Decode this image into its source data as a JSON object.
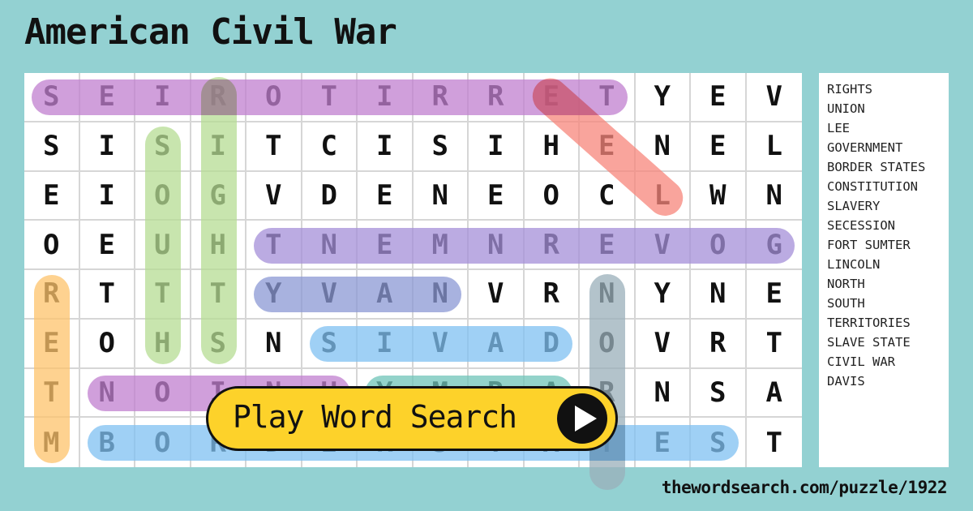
{
  "title": "American Civil War",
  "grid": {
    "rows": [
      [
        "S",
        "E",
        "I",
        "R",
        "O",
        "T",
        "I",
        "R",
        "R",
        "E",
        "T",
        "Y",
        "E",
        "V"
      ],
      [
        "S",
        "I",
        "S",
        "I",
        "T",
        "C",
        "I",
        "S",
        "I",
        "H",
        "E",
        "N",
        "E",
        "L"
      ],
      [
        "E",
        "I",
        "O",
        "G",
        "V",
        "D",
        "E",
        "N",
        "E",
        "O",
        "C",
        "L",
        "W",
        "N"
      ],
      [
        "O",
        "E",
        "U",
        "H",
        "T",
        "N",
        "E",
        "M",
        "N",
        "R",
        "E",
        "V",
        "O",
        "G"
      ],
      [
        "R",
        "T",
        "T",
        "T",
        "Y",
        "V",
        "A",
        "N",
        "V",
        "R",
        "N",
        "Y",
        "N",
        "E"
      ],
      [
        "E",
        "O",
        "H",
        "S",
        "N",
        "S",
        "I",
        "V",
        "A",
        "D",
        "O",
        "V",
        "R",
        "T"
      ],
      [
        "T",
        "N",
        "O",
        "I",
        "N",
        "U",
        "Y",
        "M",
        "R",
        "A",
        "R",
        "N",
        "S",
        "A"
      ],
      [
        "M",
        "B",
        "O",
        "R",
        "D",
        "E",
        "R",
        "S",
        "T",
        "A",
        "T",
        "E",
        "S",
        "T"
      ]
    ],
    "highlights": [
      {
        "word": "TERRITORIES",
        "start": [
          0,
          0
        ],
        "end": [
          0,
          10
        ],
        "color": "#c17fcf"
      },
      {
        "word": "LEE",
        "start": [
          2,
          11
        ],
        "end": [
          0,
          9
        ],
        "color": "#f7857a"
      },
      {
        "word": "SOUTH",
        "start": [
          1,
          2
        ],
        "end": [
          5,
          2
        ],
        "color": "#b5dd93"
      },
      {
        "word": "RIGHTS",
        "start": [
          0,
          3
        ],
        "end": [
          5,
          3
        ],
        "color": "#b5dd93"
      },
      {
        "word": "GOVERNMENT",
        "start": [
          3,
          13
        ],
        "end": [
          3,
          4
        ],
        "color": "#a48fd8"
      },
      {
        "word": "NAVY",
        "start": [
          4,
          7
        ],
        "end": [
          4,
          4
        ],
        "color": "#8b98d4"
      },
      {
        "word": "DAVIS",
        "start": [
          5,
          9
        ],
        "end": [
          5,
          5
        ],
        "color": "#7fc0f2"
      },
      {
        "word": "NORTH",
        "start": [
          4,
          10
        ],
        "end": [
          8,
          10
        ],
        "color": "#9aafba"
      },
      {
        "word": "FORT SUMTER",
        "start": [
          7,
          0
        ],
        "end": [
          4,
          0
        ],
        "color": "#fec36a"
      },
      {
        "word": "UNION",
        "start": [
          6,
          5
        ],
        "end": [
          6,
          1
        ],
        "color": "#c17fcf"
      },
      {
        "word": "ARMY",
        "start": [
          6,
          9
        ],
        "end": [
          6,
          6
        ],
        "color": "#6ec4b8"
      },
      {
        "word": "BORDER STATES",
        "start": [
          7,
          1
        ],
        "end": [
          7,
          12
        ],
        "color": "#7fc0f2"
      }
    ]
  },
  "word_list": [
    "RIGHTS",
    "UNION",
    "LEE",
    "GOVERNMENT",
    "BORDER STATES",
    "CONSTITUTION",
    "SLAVERY",
    "SECESSION",
    "FORT SUMTER",
    "LINCOLN",
    "NORTH",
    "SOUTH",
    "TERRITORIES",
    "SLAVE STATE",
    "CIVIL WAR",
    "DAVIS"
  ],
  "play_button": {
    "label": "Play Word Search",
    "icon": "play-icon"
  },
  "footer": "thewordsearch.com/puzzle/1922",
  "colors": {
    "background": "#93d1d2",
    "button": "#fdd22a"
  }
}
